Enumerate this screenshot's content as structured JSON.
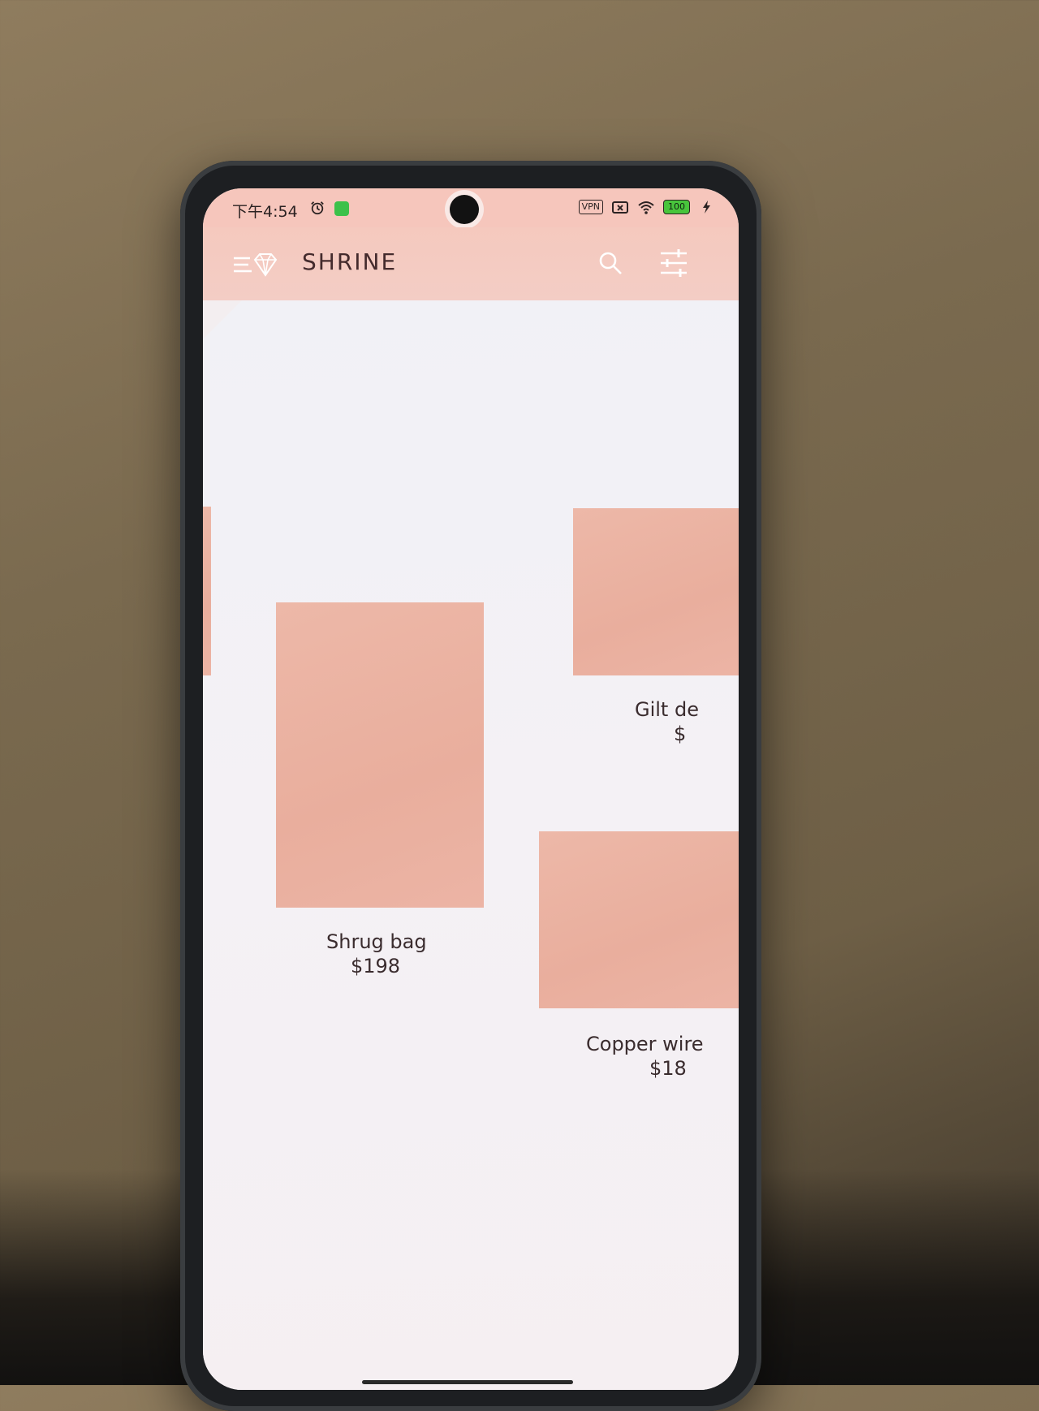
{
  "status_bar": {
    "time": "下午4:54",
    "vpn": "VPN",
    "battery": "100"
  },
  "app_bar": {
    "title": "SHRINE"
  },
  "products": [
    {
      "name": "Shrug bag",
      "price": "$198"
    },
    {
      "name": "Gilt de",
      "price": "$"
    },
    {
      "name": "Copper wire",
      "price": "$18"
    }
  ],
  "colors": {
    "primary_pink": "#f5c9be",
    "product_placeholder": "#ebb2a2",
    "text_dark": "#442b2d",
    "battery_green": "#48c53c"
  },
  "icons": [
    "alarm-icon",
    "wechat-icon",
    "sim-icon",
    "wifi-icon",
    "bolt-icon",
    "menu-icon",
    "diamond-logo-icon",
    "search-icon",
    "tune-icon"
  ]
}
